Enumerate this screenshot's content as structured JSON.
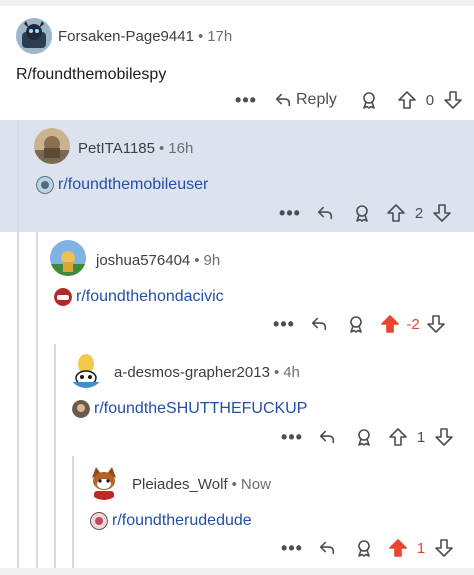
{
  "colors": {
    "accent_upvote": "#e8452c",
    "link": "#2250a8",
    "highlight": "#dde3ee"
  },
  "comments": [
    {
      "username": "Forsaken-Page9441",
      "separator": "•",
      "time": "17h",
      "text": "R/foundthemobilespy",
      "more_label": "•••",
      "reply_label": "Reply",
      "score": "0",
      "voted_up": false
    },
    {
      "username": "PetITA1185",
      "separator": "•",
      "time": "16h",
      "subreddit": "r/foundthemobileuser",
      "more_label": "•••",
      "score": "2",
      "voted_up": false
    },
    {
      "username": "joshua576404",
      "separator": "•",
      "time": "9h",
      "subreddit": "r/foundthehondacivic",
      "more_label": "•••",
      "score": "-2",
      "voted_up": true
    },
    {
      "username": "a-desmos-grapher2013",
      "separator": "•",
      "time": "4h",
      "subreddit": "r/foundtheSHUTTHEFUCKUP",
      "more_label": "•••",
      "score": "1",
      "voted_up": false
    },
    {
      "username": "Pleiades_Wolf",
      "separator": "•",
      "time": "Now",
      "subreddit": "r/foundtherudedude",
      "more_label": "•••",
      "score": "1",
      "voted_up": true
    }
  ]
}
